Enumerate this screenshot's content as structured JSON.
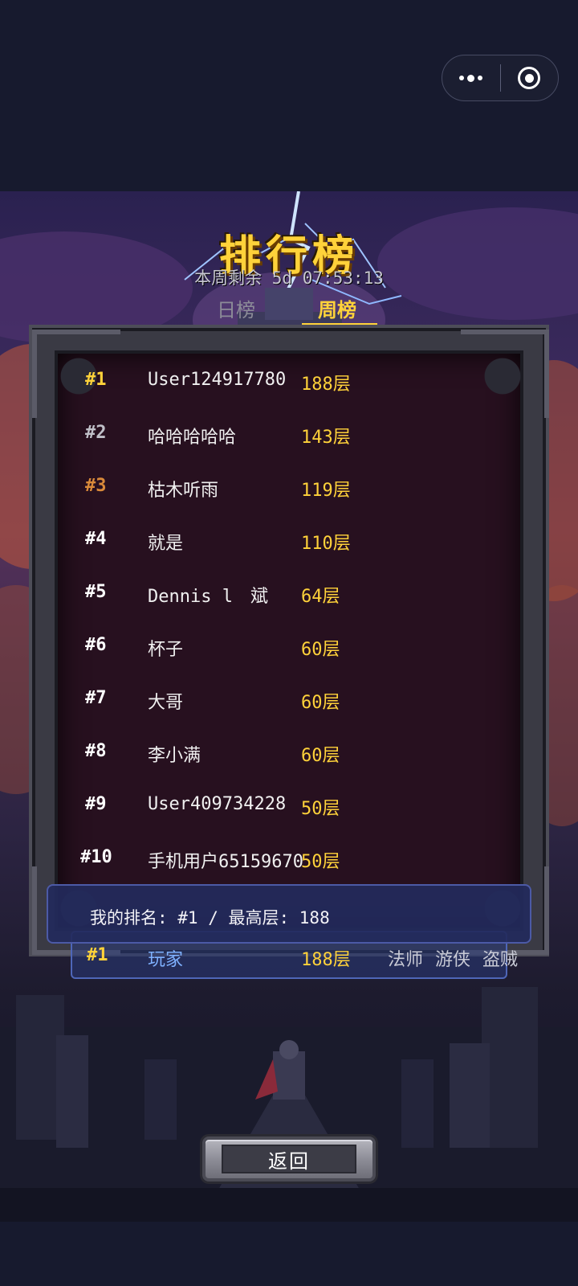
{
  "capsule": {
    "more_icon": "more-dots-icon",
    "close_icon": "target-circle-icon"
  },
  "header": {
    "title": "排行榜",
    "countdown": "本周剩余 5d 07:53:13",
    "tabs": [
      {
        "label": "日榜",
        "active": false
      },
      {
        "label": "周榜",
        "active": true
      }
    ]
  },
  "leaderboard": [
    {
      "rank": "#1",
      "name": "User124917780",
      "floor": "188层",
      "rank_color": "#ffd23a"
    },
    {
      "rank": "#2",
      "name": "哈哈哈哈哈",
      "floor": "143层",
      "rank_color": "#c0c0c8"
    },
    {
      "rank": "#3",
      "name": "枯木听雨",
      "floor": "119层",
      "rank_color": "#d98a3a"
    },
    {
      "rank": "#4",
      "name": "就是",
      "floor": "110层",
      "rank_color": "#ffffff"
    },
    {
      "rank": "#5",
      "name": "Dennis l　斌",
      "floor": "64层",
      "rank_color": "#ffffff"
    },
    {
      "rank": "#6",
      "name": "杯子",
      "floor": "60层",
      "rank_color": "#ffffff"
    },
    {
      "rank": "#7",
      "name": "大哥",
      "floor": "60层",
      "rank_color": "#ffffff"
    },
    {
      "rank": "#8",
      "name": "李小满",
      "floor": "60层",
      "rank_color": "#ffffff"
    },
    {
      "rank": "#9",
      "name": "User409734228",
      "floor": "50层",
      "rank_color": "#ffffff"
    },
    {
      "rank": "#10",
      "name": "手机用户65159670",
      "floor": "50层",
      "rank_color": "#ffffff"
    }
  ],
  "my_rank": {
    "text": "我的排名: #1 / 最高层: 188"
  },
  "player": {
    "rank": "#1",
    "name": "玩家",
    "floor": "188层",
    "classes": [
      "法师",
      "游侠",
      "盗贼"
    ]
  },
  "back_button": {
    "label": "返回"
  },
  "colors": {
    "accent_gold": "#ffd23a",
    "panel_blue": "#232a5c",
    "frame_stone": "#3a3a44"
  }
}
